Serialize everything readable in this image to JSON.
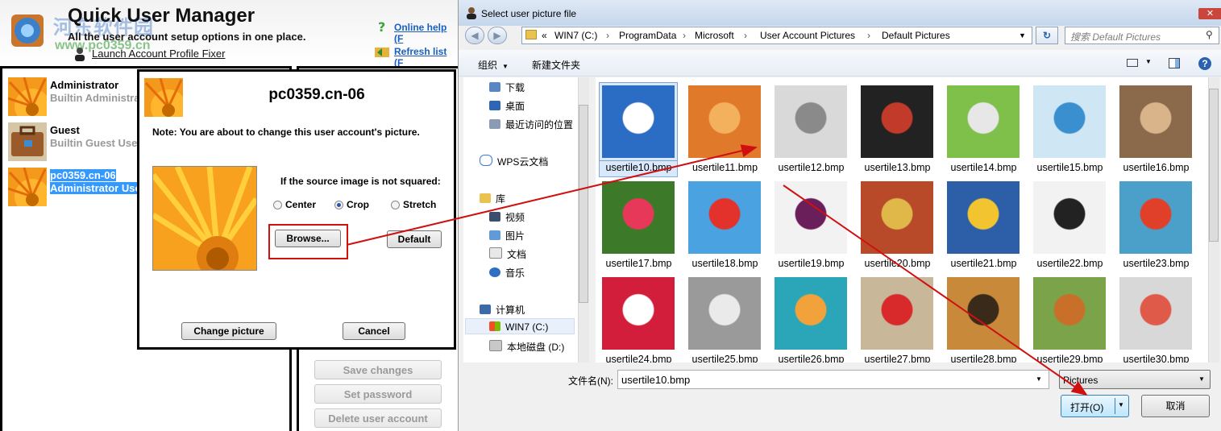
{
  "app": {
    "title": "Quick User Manager",
    "subtitle": "All the user account setup options in one place.",
    "launch_link": "Launch Account Profile Fixer",
    "online_help": "Online help (F",
    "refresh_list": "Refresh list (F",
    "watermark_cn": "河东软件园",
    "watermark_url": "www.pc0359.cn"
  },
  "users": [
    {
      "name": "Administrator",
      "role": "Builtin Administra",
      "icon": "orange-flower-icon",
      "selected": false
    },
    {
      "name": "Guest",
      "role": "Builtin Guest Use",
      "icon": "suitcase-icon",
      "selected": false
    },
    {
      "name": "pc0359.cn-06",
      "role": "Administrator Use",
      "icon": "orange-flower-icon",
      "selected": true
    }
  ],
  "actions": {
    "save_changes": "Save changes",
    "set_password": "Set password",
    "delete_user": "Delete user account"
  },
  "picture_dialog": {
    "title": "pc0359.cn-06",
    "note": "Note: You are about to change this user account's picture.",
    "source_label": "If the source image is not squared:",
    "options": [
      "Center",
      "Crop",
      "Stretch"
    ],
    "selected_option": "Crop",
    "browse": "Browse...",
    "default": "Default",
    "change_picture": "Change picture",
    "cancel": "Cancel"
  },
  "file_dialog": {
    "title": "Select user picture file",
    "path": [
      "WIN7 (C:)",
      "ProgramData",
      "Microsoft",
      "User Account Pictures",
      "Default Pictures"
    ],
    "path_prefix": "«",
    "search_placeholder": "搜索 Default Pictures",
    "toolbar": {
      "organize": "组织",
      "new_folder": "新建文件夹"
    },
    "nav": {
      "favorites": [
        "下载",
        "桌面",
        "最近访问的位置"
      ],
      "wps": "WPS云文档",
      "libraries": "库",
      "library_items": [
        "视频",
        "图片",
        "文档",
        "音乐"
      ],
      "computer": "计算机",
      "drives": [
        "WIN7 (C:)",
        "本地磁盘 (D:)"
      ]
    },
    "files": [
      "usertile10.bmp",
      "usertile11.bmp",
      "usertile12.bmp",
      "usertile13.bmp",
      "usertile14.bmp",
      "usertile15.bmp",
      "usertile16.bmp",
      "usertile17.bmp",
      "usertile18.bmp",
      "usertile19.bmp",
      "usertile20.bmp",
      "usertile21.bmp",
      "usertile22.bmp",
      "usertile23.bmp",
      "usertile24.bmp",
      "usertile25.bmp",
      "usertile26.bmp",
      "usertile27.bmp",
      "usertile28.bmp",
      "usertile29.bmp",
      "usertile30.bmp"
    ],
    "selected_file": "usertile10.bmp",
    "filename_label": "文件名(N):",
    "filename_value": "usertile10.bmp",
    "filetype_value": "Pictures",
    "open": "打开(O)",
    "cancel": "取消"
  },
  "colors": {
    "selection": "#3399ff",
    "annotation": "#d01010",
    "link": "#1a5fc0"
  }
}
